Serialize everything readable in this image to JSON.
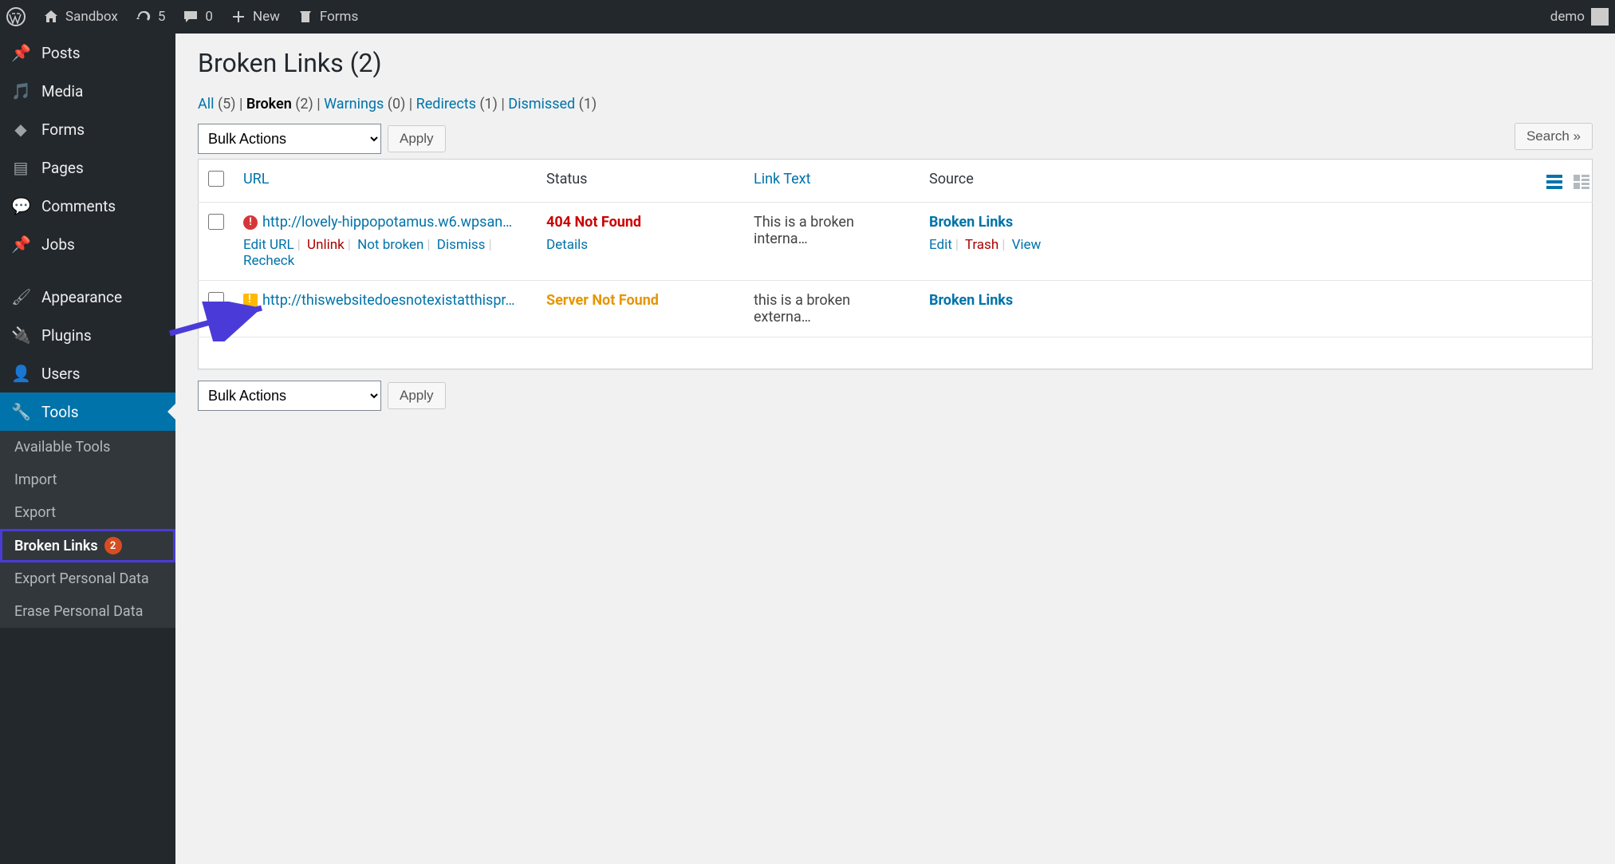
{
  "adminbar": {
    "site_name": "Sandbox",
    "updates": "5",
    "comments": "0",
    "new_label": "New",
    "forms_label": "Forms",
    "user": "demo"
  },
  "sidebar": {
    "items": [
      {
        "icon": "pin",
        "label": "Posts"
      },
      {
        "icon": "media",
        "label": "Media"
      },
      {
        "icon": "forms",
        "label": "Forms"
      },
      {
        "icon": "page",
        "label": "Pages"
      },
      {
        "icon": "comment",
        "label": "Comments"
      },
      {
        "icon": "pin",
        "label": "Jobs"
      },
      {
        "icon": "brush",
        "label": "Appearance"
      },
      {
        "icon": "plug",
        "label": "Plugins"
      },
      {
        "icon": "user",
        "label": "Users"
      },
      {
        "icon": "wrench",
        "label": "Tools"
      }
    ],
    "submenu": [
      {
        "label": "Available Tools"
      },
      {
        "label": "Import"
      },
      {
        "label": "Export"
      },
      {
        "label": "Broken Links",
        "badge": "2"
      },
      {
        "label": "Export Personal Data"
      },
      {
        "label": "Erase Personal Data"
      }
    ]
  },
  "page": {
    "title": "Broken Links (2)",
    "filters": [
      {
        "label": "All",
        "count": "(5)"
      },
      {
        "label": "Broken",
        "count": "(2)",
        "current": true
      },
      {
        "label": "Warnings",
        "count": "(0)"
      },
      {
        "label": "Redirects",
        "count": "(1)"
      },
      {
        "label": "Dismissed",
        "count": "(1)"
      }
    ],
    "bulk_label": "Bulk Actions",
    "apply_label": "Apply",
    "search_label": "Search »"
  },
  "table": {
    "headers": {
      "url": "URL",
      "status": "Status",
      "linktext": "Link Text",
      "source": "Source"
    },
    "rows": [
      {
        "icon": "error",
        "url": "http://lovely-hippopotamus.w6.wpsan…",
        "status": "404 Not Found",
        "status_class": "status-404",
        "details": "Details",
        "linktext": "This is a broken interna…",
        "source": "Broken Links",
        "row_actions": {
          "edit_url": "Edit URL",
          "unlink": "Unlink",
          "not_broken": "Not broken",
          "dismiss": "Dismiss",
          "recheck": "Recheck"
        },
        "source_actions": {
          "edit": "Edit",
          "trash": "Trash",
          "view": "View"
        }
      },
      {
        "icon": "warn",
        "url": "http://thiswebsitedoesnotexistatthispr…",
        "status": "Server Not Found",
        "status_class": "status-server",
        "linktext": "this is a broken externa…",
        "source": "Broken Links"
      }
    ]
  }
}
